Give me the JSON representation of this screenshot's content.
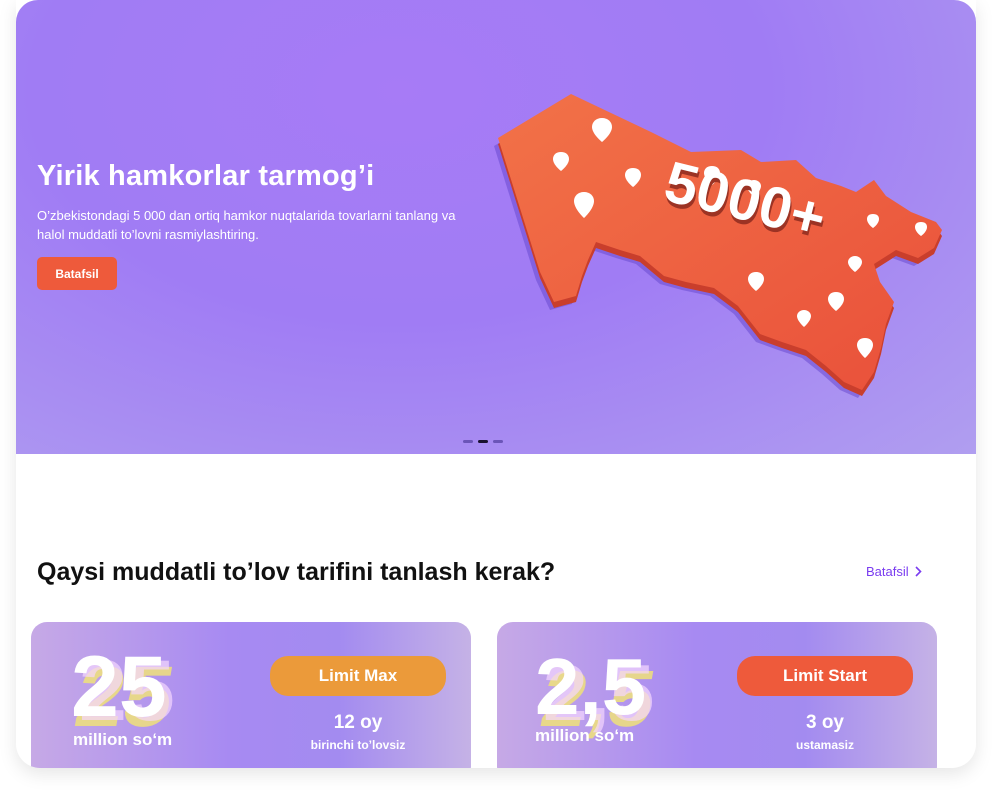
{
  "hero": {
    "title": "Yirik hamkorlar tarmog’i",
    "description": "O’zbekistondagi 5 000 dan ortiq hamkor nuqtalarida tovarlarni tanlang va halol muddatli to’lovni rasmiylashtiring.",
    "button_label": "Batafsil",
    "map_badge": "5000+",
    "colors": {
      "background": "#a77bf6",
      "button": "#ee5a3b",
      "map": "#ee5a3b"
    },
    "carousel": {
      "slides": 3,
      "active_index": 1
    }
  },
  "section": {
    "title": "Qaysi muddatli to’lov tarifini tanlash kerak?",
    "more_label": "Batafsil"
  },
  "tariffs": [
    {
      "amount": "25",
      "unit": "million so‘m",
      "name": "Limit Max",
      "term": "12 oy",
      "note": "birinchi to’lovsiz",
      "pill_color": "#eb9a3a"
    },
    {
      "amount": "2,5",
      "unit": "million so‘m",
      "name": "Limit Start",
      "term": "3 oy",
      "note": "ustamasiz",
      "pill_color": "#ee5a3b"
    }
  ]
}
